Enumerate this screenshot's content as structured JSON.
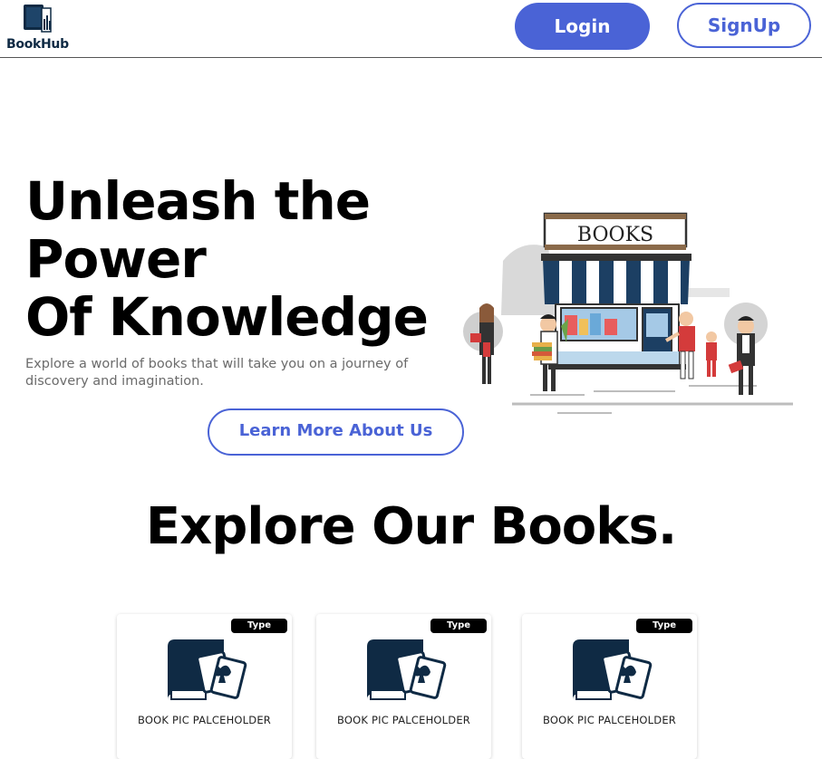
{
  "brand": {
    "name": "BookHub",
    "icon": "book-stack-icon",
    "color": "#0f2a44"
  },
  "nav": {
    "login_label": "Login",
    "signup_label": "SignUp"
  },
  "hero": {
    "title_line1": "Unleash the",
    "title_line2": "Power",
    "title_line3": "Of Knowledge",
    "subtitle": "Explore a world of books that will take you on a journey of discovery and imagination.",
    "cta_label": "Learn More About Us",
    "illustration": {
      "icon": "bookstore-illustration",
      "sign_text": "BOOKS"
    }
  },
  "books_section": {
    "title": "Explore Our Books.",
    "cards": [
      {
        "badge": "Type",
        "caption": "BOOK PIC PALCEHOLDER",
        "icon": "book-cards-icon"
      },
      {
        "badge": "Type",
        "caption": "BOOK PIC PALCEHOLDER",
        "icon": "book-cards-icon"
      },
      {
        "badge": "Type",
        "caption": "BOOK PIC PALCEHOLDER",
        "icon": "book-cards-icon"
      }
    ]
  },
  "colors": {
    "accent": "#4a63d6",
    "text": "#000000",
    "muted_text": "#6b6b6b",
    "brand_dark": "#0f2a44"
  }
}
